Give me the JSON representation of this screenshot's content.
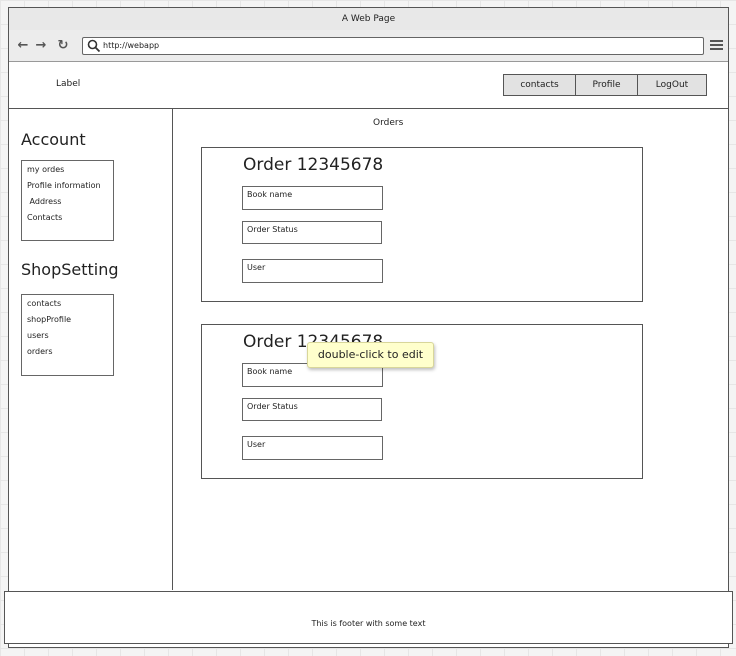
{
  "window": {
    "title": "A Web Page"
  },
  "browser": {
    "url": "http://webapp",
    "icons": {
      "back": "arrow-left-icon",
      "forward": "arrow-right-icon",
      "reload": "reload-icon",
      "search": "search-icon",
      "menu": "hamburger-menu-icon"
    }
  },
  "header": {
    "label": "Label",
    "nav": [
      "contacts",
      "Profile",
      "LogOut"
    ]
  },
  "sidebar": {
    "account_heading": "Account",
    "account_items": [
      "my ordes",
      "Profile information",
      " Address",
      "Contacts"
    ],
    "shop_heading": "ShopSetting",
    "shop_items": [
      "contacts",
      "shopProfile",
      "users",
      "orders"
    ]
  },
  "main": {
    "title": "Orders",
    "orders": [
      {
        "title": "Order 12345678",
        "book": "Book name",
        "status": "Order Status",
        "user": "User"
      },
      {
        "title": "Order 12345678",
        "book": "Book name",
        "status": "Order Status",
        "user": "User"
      }
    ]
  },
  "tooltip": "double-click to edit",
  "footer": {
    "text": "This is footer with some text"
  },
  "colors": {
    "tooltip_bg": "#ffffcc",
    "nav_bg": "#e2e2e2",
    "chrome_bg": "#ececec"
  }
}
